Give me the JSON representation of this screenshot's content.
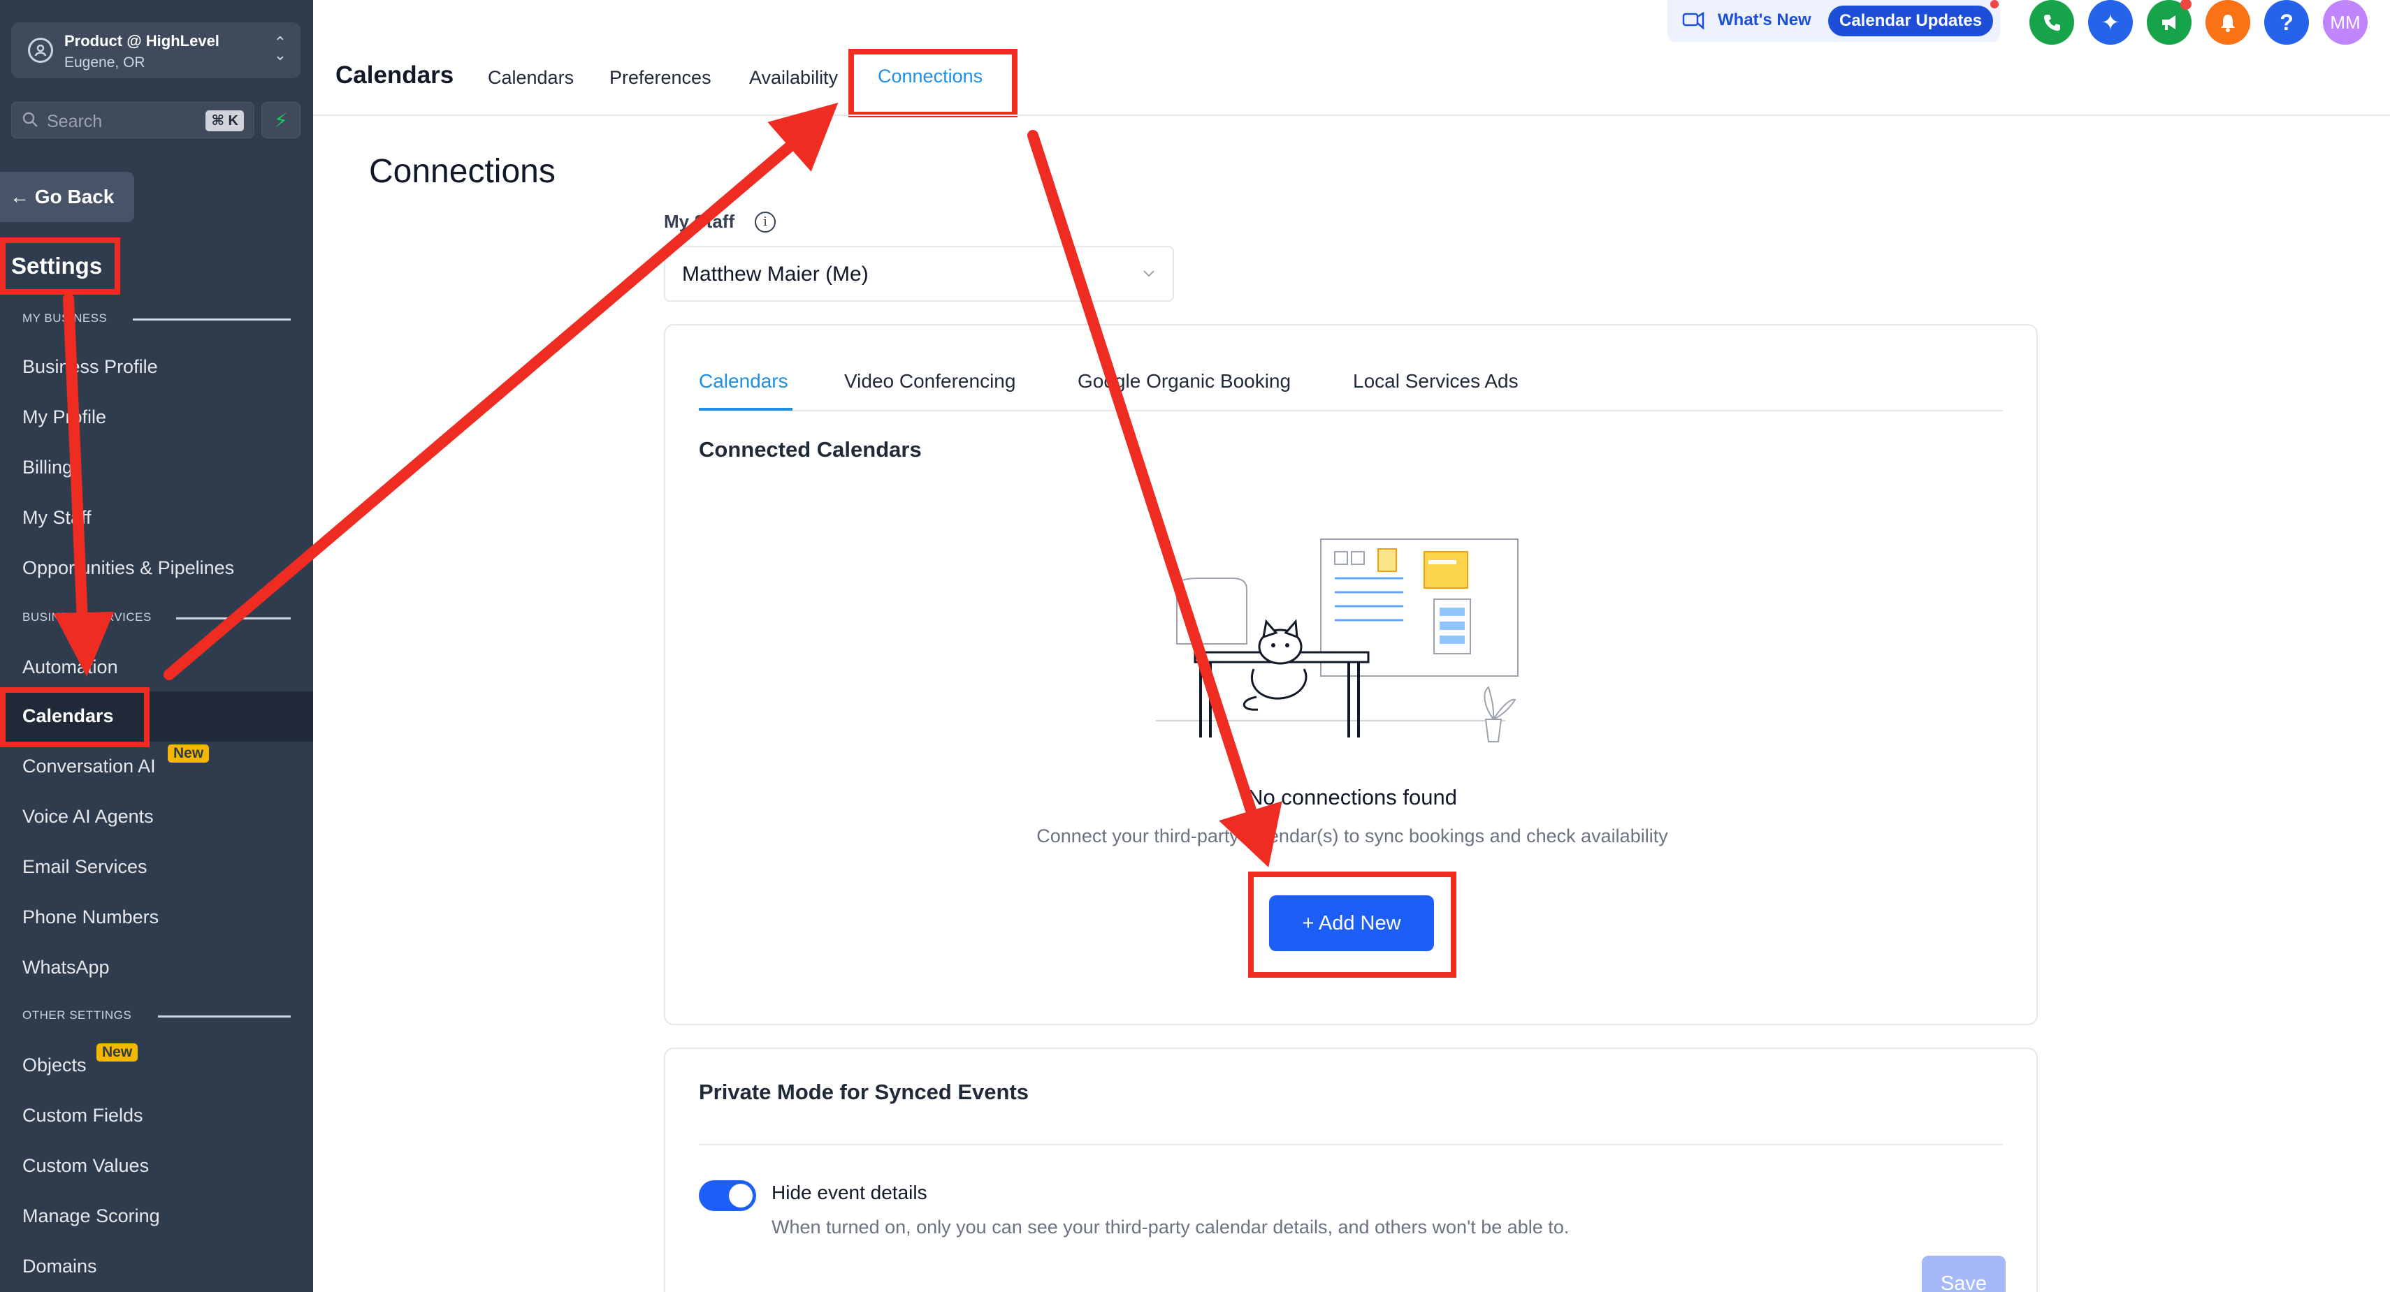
{
  "account": {
    "name": "Product @ HighLevel",
    "location": "Eugene, OR"
  },
  "search": {
    "placeholder": "Search",
    "shortcut": "⌘ K"
  },
  "sidebar": {
    "go_back": "Go Back",
    "title": "Settings",
    "sections": {
      "my_business": "MY BUSINESS",
      "business_services": "BUSINESS SERVICES",
      "other_settings": "OTHER SETTINGS"
    },
    "items": [
      {
        "label": "Business Profile"
      },
      {
        "label": "My Profile"
      },
      {
        "label": "Billing"
      },
      {
        "label": "My Staff"
      },
      {
        "label": "Opportunities & Pipelines"
      },
      {
        "label": "Automation"
      },
      {
        "label": "Calendars"
      },
      {
        "label": "Conversation AI",
        "badge": "New"
      },
      {
        "label": "Voice AI Agents"
      },
      {
        "label": "Email Services"
      },
      {
        "label": "Phone Numbers"
      },
      {
        "label": "WhatsApp"
      },
      {
        "label": "Objects",
        "badge": "New"
      },
      {
        "label": "Custom Fields"
      },
      {
        "label": "Custom Values"
      },
      {
        "label": "Manage Scoring"
      },
      {
        "label": "Domains"
      }
    ],
    "active": "Calendars"
  },
  "header": {
    "title": "Calendars",
    "tabs": [
      {
        "label": "Calendars"
      },
      {
        "label": "Preferences"
      },
      {
        "label": "Availability"
      },
      {
        "label": "Connections"
      }
    ],
    "active_tab": "Connections",
    "whats_new": "What's New",
    "calendar_updates": "Calendar Updates",
    "help_label": "?",
    "user_initials": "MM"
  },
  "main": {
    "page_title": "Connections",
    "staff_label": "My Staff",
    "staff_value": "Matthew Maier (Me)",
    "sub_tabs": [
      {
        "label": "Calendars"
      },
      {
        "label": "Video Conferencing"
      },
      {
        "label": "Google Organic Booking"
      },
      {
        "label": "Local Services Ads"
      }
    ],
    "active_sub_tab": "Calendars",
    "connected_heading": "Connected Calendars",
    "empty_title": "No connections found",
    "empty_desc": "Connect your third-party calendar(s) to sync bookings and check availability",
    "add_new": "Add New",
    "private_heading": "Private Mode for Synced Events",
    "toggle_label": "Hide event details",
    "toggle_on": true,
    "toggle_desc": "When turned on, only you can see your third-party calendar details, and others won't be able to.",
    "save": "Save"
  },
  "colors": {
    "sidebar_bg": "#2f3c4e",
    "accent": "#1d5ff6",
    "tab_active": "#1d8fe5",
    "annotation_red": "#ef2c22",
    "badge": "#f5b800"
  },
  "icons": [
    "user-circle-icon",
    "chevron-updown-icon",
    "search-icon",
    "bolt-icon",
    "arrow-left-icon",
    "info-icon",
    "chevron-down-icon",
    "megaphone-icon",
    "phone-icon",
    "sparkle-icon",
    "announcement-icon",
    "bell-icon",
    "help-icon",
    "plus-icon"
  ]
}
